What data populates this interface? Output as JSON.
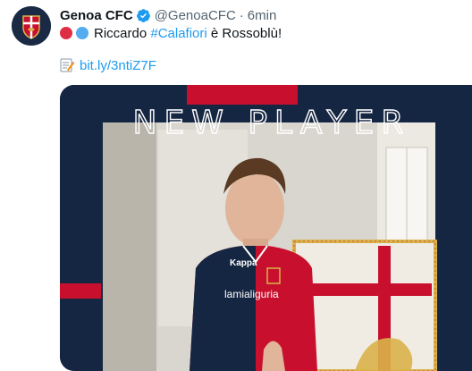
{
  "tweet": {
    "author_name": "Genoa CFC",
    "author_handle": "@GenoaCFC",
    "separator": "·",
    "time": "6min",
    "text_before": "Riccardo ",
    "hashtag": "#Calafiori",
    "text_after": " è Rossoblù!",
    "link": "bit.ly/3ntiZ7F",
    "icons": [
      "verified-badge-icon",
      "red-circle-icon",
      "blue-circle-icon",
      "memo-icon"
    ],
    "colors": {
      "red_circle": "#dd2e44",
      "blue_circle": "#55acee",
      "link": "#1d9bf0",
      "verified": "#1d9bf0"
    }
  },
  "media": {
    "headline": "NEW PLAYER",
    "shirt_sponsor": "lamialiguria",
    "kit_brand": "Kappa",
    "colors": {
      "navy": "#152642",
      "red": "#c8102e"
    }
  }
}
